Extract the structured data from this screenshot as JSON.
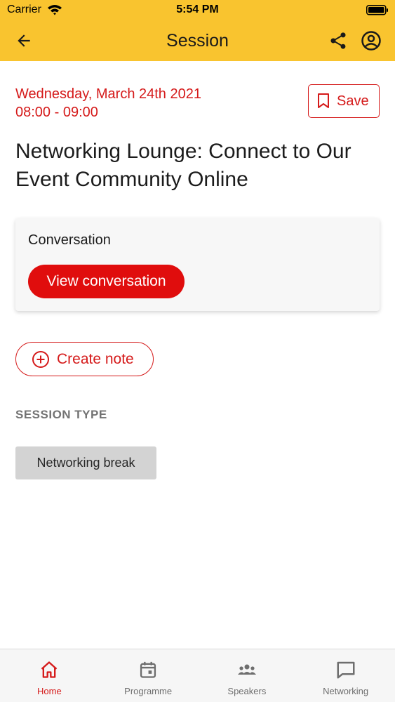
{
  "status_bar": {
    "carrier": "Carrier",
    "time": "5:54 PM"
  },
  "header": {
    "title": "Session",
    "background": "#f9c42f"
  },
  "session": {
    "date": "Wednesday, March 24th 2021",
    "time_range": "08:00 - 09:00",
    "title": "Networking Lounge: Connect to Our Event Community Online",
    "save_label": "Save"
  },
  "conversation": {
    "label": "Conversation",
    "button_label": "View conversation"
  },
  "note": {
    "button_label": "Create note"
  },
  "session_type": {
    "heading": "SESSION TYPE",
    "value": "Networking break"
  },
  "tabs": [
    {
      "label": "Home",
      "icon": "home-icon",
      "active": true
    },
    {
      "label": "Programme",
      "icon": "calendar-icon",
      "active": false
    },
    {
      "label": "Speakers",
      "icon": "people-icon",
      "active": false
    },
    {
      "label": "Networking",
      "icon": "chat-icon",
      "active": false
    }
  ],
  "colors": {
    "accent": "#d51a1a",
    "primary_button": "#e00d0d",
    "header": "#f9c42f"
  }
}
